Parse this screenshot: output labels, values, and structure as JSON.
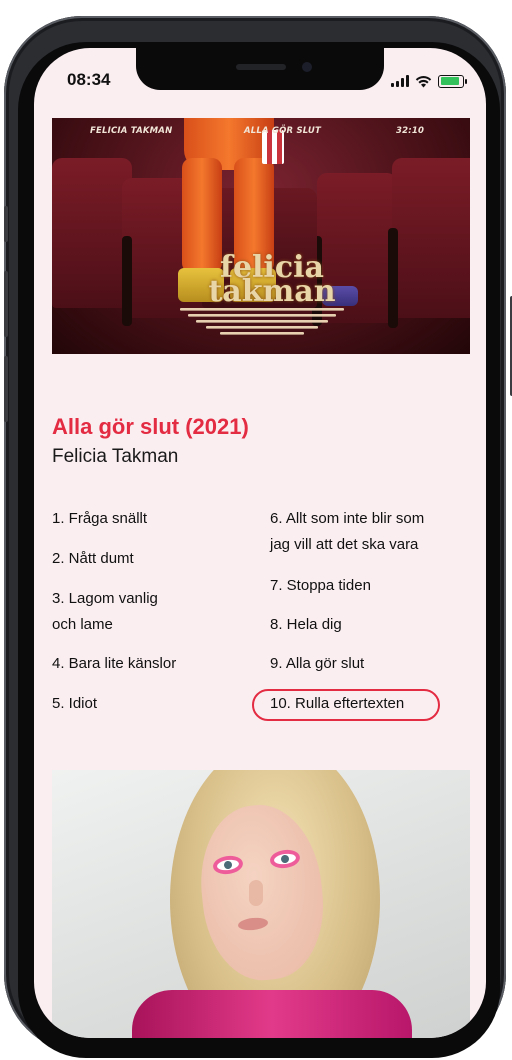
{
  "status_bar": {
    "time": "08:34"
  },
  "album_art": {
    "artist_top": "FELICIA TAKMAN",
    "title_top": "ALLA GÖR SLUT",
    "duration_top": "32:10",
    "logo_line1": "felicia",
    "logo_line2": "takman"
  },
  "album": {
    "title": "Alla gör slut (2021)",
    "artist": "Felicia Takman"
  },
  "tracks": {
    "t1": "1. Fråga snällt",
    "t2": "2. Nått dumt",
    "t3a": "3. Lagom vanlig",
    "t3b": "och lame",
    "t4": "4. Bara lite känslor",
    "t5": "5. Idiot",
    "t6a": "6. Allt som inte blir som",
    "t6b": "jag vill att det ska vara",
    "t7": "7. Stoppa tiden",
    "t8": "8. Hela dig",
    "t9": "9. Alla gör slut",
    "t10": "10. Rulla eftertexten"
  },
  "colors": {
    "accent": "#e32b42",
    "screen_bg": "#fbeef1",
    "text": "#111111"
  },
  "icons": [
    "signal-icon",
    "wifi-icon",
    "battery-charging-icon"
  ]
}
